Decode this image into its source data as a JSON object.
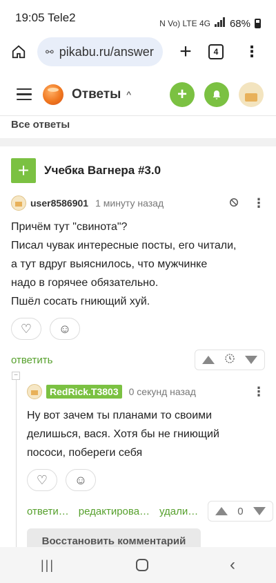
{
  "status": {
    "time": "19:05",
    "carrier": "Tele2",
    "indicators": "N  Vo) LTE 4G",
    "battery": "68%"
  },
  "browser": {
    "url": "pikabu.ru/answer",
    "tabs_count": "4"
  },
  "header": {
    "section": "Ответы"
  },
  "page": {
    "subtitle": "Все ответы",
    "post_title": "Учебка Вагнера #3.0"
  },
  "comments": [
    {
      "username": "user8586901",
      "time": "1 минуту назад",
      "lines": [
        "Причём тут \"свинота\"?",
        "Писал чувак интересные посты, его читали,",
        "а тут вдруг выяснилось, что мужчинке",
        "надо в горячее обязательно.",
        "Пшёл сосать гниющий хуй."
      ],
      "reply_label": "ответить"
    },
    {
      "username": "RedRick.T3803",
      "time": "0 секунд назад",
      "lines": [
        "Ну вот зачем ты планами то своими",
        "делишься, вася. Хотя бы не гниющий",
        "пососи, побереги себя"
      ],
      "reply_label": "ответи…",
      "edit_label": "редактирова…",
      "delete_label": "удали…",
      "rating": "0"
    }
  ],
  "restore_label": "Восстановить комментарий",
  "icons": [
    "home-icon",
    "site-settings-icon",
    "plus-icon",
    "tabs-icon",
    "more-vert-icon",
    "hamburger-icon",
    "caret-up-icon",
    "bell-icon",
    "heart-icon",
    "add-reaction-icon",
    "block-icon",
    "clock-icon",
    "arrow-up-icon",
    "arrow-down-icon"
  ],
  "colors": {
    "accent_green": "#7bc142",
    "link_green": "#56a02c"
  }
}
